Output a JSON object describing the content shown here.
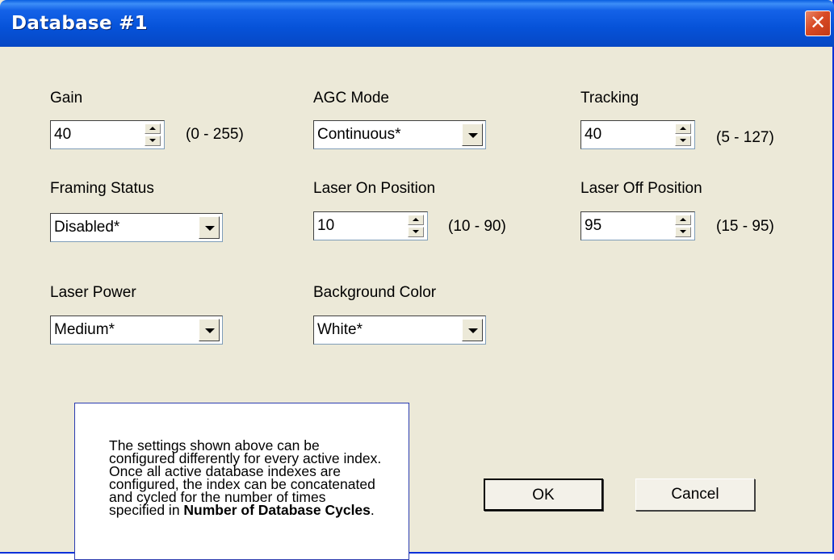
{
  "window": {
    "title": "Database #1",
    "close_symbol": "✕"
  },
  "fields": {
    "gain": {
      "label": "Gain",
      "value": "40",
      "range": "(0 - 255)"
    },
    "agc_mode": {
      "label": "AGC Mode",
      "value": "Continuous*"
    },
    "tracking": {
      "label": "Tracking",
      "value": "40",
      "range": "(5 - 127)"
    },
    "framing_status": {
      "label": "Framing Status",
      "value": "Disabled*"
    },
    "laser_on": {
      "label": "Laser On Position",
      "value": "10",
      "range": "(10 - 90)"
    },
    "laser_off": {
      "label": "Laser Off Position",
      "value": "95",
      "range": "(15 - 95)"
    },
    "laser_power": {
      "label": "Laser Power",
      "value": "Medium*"
    },
    "background_color": {
      "label": "Background Color",
      "value": "White*"
    }
  },
  "buttons": {
    "ok": "OK",
    "cancel": "Cancel"
  },
  "note": {
    "text": "The settings shown above can be configured differently for every active index. Once all active database indexes are configured, the index can be concatenated and cycled for the number of times specified in ",
    "bold": "Number of Database Cycles",
    "end": "."
  },
  "colors": {
    "title_bar": "#0652d8",
    "dialog_bg": "#ece9d8",
    "close_button": "#d84a24",
    "note_border": "#2a3bb0"
  }
}
